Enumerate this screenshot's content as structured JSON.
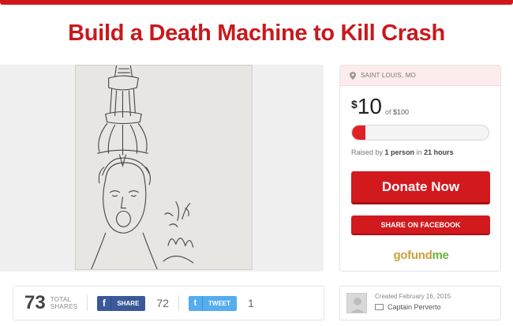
{
  "campaign": {
    "title": "Build a Death Machine to Kill Crash"
  },
  "sidebar": {
    "location": "SAINT LOUIS, MO",
    "currency_symbol": "$",
    "raised_amount": "10",
    "goal_prefix": "of",
    "goal_amount": "$100",
    "progress_fraction": 0.1,
    "raised_by_prefix": "Raised by",
    "raised_by_people": "1 person",
    "raised_by_mid": "in",
    "raised_by_time": "21 hours",
    "donate_label": "Donate Now",
    "share_facebook_label": "SHARE ON FACEBOOK",
    "brand_go": "go",
    "brand_fund": "fund",
    "brand_me": "me"
  },
  "shares": {
    "total": "73",
    "total_label_1": "TOTAL",
    "total_label_2": "SHARES",
    "facebook_label": "SHARE",
    "facebook_count": "72",
    "twitter_label": "TWEET",
    "twitter_count": "1"
  },
  "creator": {
    "created_text": "Created February 16, 2015",
    "name": "Captain Perverto"
  },
  "colors": {
    "brand_red": "#d2191e",
    "facebook_blue": "#3b5998",
    "twitter_blue": "#55acee"
  },
  "icons": [
    "location-pin-icon",
    "facebook-icon",
    "twitter-icon",
    "mail-icon",
    "avatar-placeholder-icon"
  ]
}
